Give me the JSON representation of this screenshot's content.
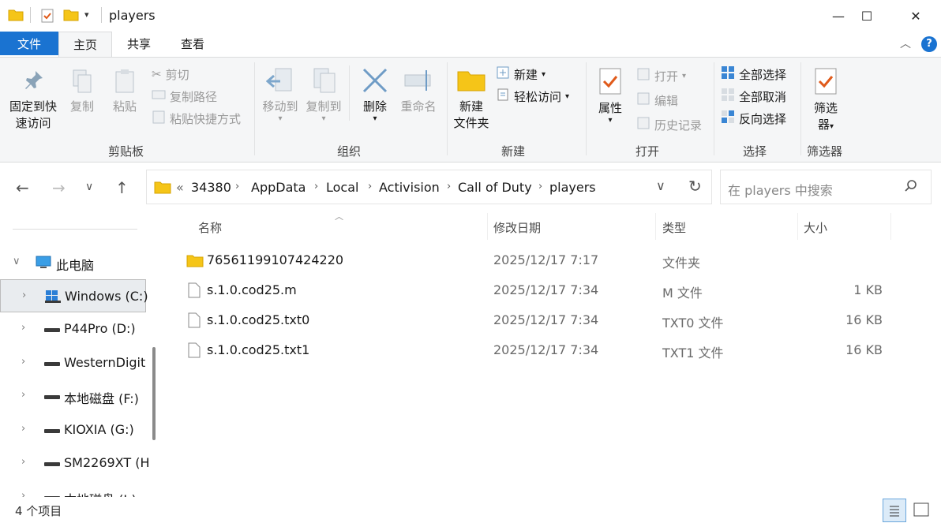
{
  "window": {
    "title": "players",
    "controls": {
      "minimize": "—",
      "maximize": "☐",
      "close": "✕"
    }
  },
  "tabs": [
    "文件",
    "主页",
    "共享",
    "查看"
  ],
  "ribbon": {
    "clipboard": {
      "pin": [
        "固定到快",
        "速访问"
      ],
      "copy": "复制",
      "paste": "粘贴",
      "cut": "剪切",
      "copy_path": "复制路径",
      "paste_shortcut": "粘贴快捷方式",
      "label": "剪贴板"
    },
    "organize": {
      "move_to": "移动到",
      "copy_to": "复制到",
      "delete": "删除",
      "rename": "重命名",
      "label": "组织"
    },
    "new": {
      "new_folder": [
        "新建",
        "文件夹"
      ],
      "new_item": "新建",
      "easy_access": "轻松访问",
      "label": "新建"
    },
    "open": {
      "properties": "属性",
      "open": "打开",
      "edit": "编辑",
      "history": "历史记录",
      "label": "打开"
    },
    "select": {
      "select_all": "全部选择",
      "select_none": "全部取消",
      "invert": "反向选择",
      "label": "选择"
    },
    "filter": {
      "filter_btn": [
        "筛选",
        "器"
      ],
      "label": "筛选器"
    }
  },
  "address": {
    "overflow": "«",
    "crumbs": [
      "34380",
      "AppData",
      "Local",
      "Activision",
      "Call of Duty",
      "players"
    ]
  },
  "search": {
    "placeholder": "在 players 中搜索"
  },
  "columns": {
    "name": "名称",
    "date": "修改日期",
    "type": "类型",
    "size": "大小"
  },
  "files": [
    {
      "name": "76561199107424220",
      "date": "2025/12/17 7:17",
      "type": "文件夹",
      "size": "",
      "kind": "folder"
    },
    {
      "name": "s.1.0.cod25.m",
      "date": "2025/12/17 7:34",
      "type": "M 文件",
      "size": "1 KB",
      "kind": "file"
    },
    {
      "name": "s.1.0.cod25.txt0",
      "date": "2025/12/17 7:34",
      "type": "TXT0 文件",
      "size": "16 KB",
      "kind": "file"
    },
    {
      "name": "s.1.0.cod25.txt1",
      "date": "2025/12/17 7:34",
      "type": "TXT1 文件",
      "size": "16 KB",
      "kind": "file"
    }
  ],
  "sidebar": {
    "this_pc": "此电脑",
    "drives": [
      "Windows (C:)",
      "P44Pro (D:)",
      "WesternDigit",
      "本地磁盘 (F:)",
      "KIOXIA (G:)",
      "SM2269XT (H",
      "本地磁盘 (I:)"
    ]
  },
  "status": {
    "count": "4 个项目"
  },
  "colors": {
    "accent": "#1a73d1",
    "folder": "#f5c518",
    "ribbon_bg": "#f5f6f7"
  }
}
